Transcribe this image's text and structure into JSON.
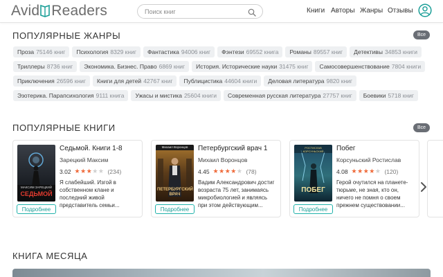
{
  "header": {
    "logo_left": "Avid",
    "logo_right": "Readers",
    "search_placeholder": "Поиск книг",
    "nav": [
      "Книги",
      "Авторы",
      "Жанры",
      "Отзывы"
    ]
  },
  "genres": {
    "title": "ПОПУЛЯРНЫЕ ЖАНРЫ",
    "all_label": "Все",
    "items": [
      {
        "name": "Проза",
        "count": "75146 книг"
      },
      {
        "name": "Психология",
        "count": "8329 книг"
      },
      {
        "name": "Фантастика",
        "count": "94006 книг"
      },
      {
        "name": "Фэнтези",
        "count": "69552 книга"
      },
      {
        "name": "Романы",
        "count": "89557 книг"
      },
      {
        "name": "Детективы",
        "count": "34853 книги"
      },
      {
        "name": "Триллеры",
        "count": "8736 книг"
      },
      {
        "name": "Экономика. Бизнес. Право",
        "count": "6869 книг"
      },
      {
        "name": "История. Исторические науки",
        "count": "31475 книг"
      },
      {
        "name": "Самосовершенствование",
        "count": "7804 книги"
      },
      {
        "name": "Приключения",
        "count": "26596 книг"
      },
      {
        "name": "Книги для детей",
        "count": "42767 книг"
      },
      {
        "name": "Публицистика",
        "count": "44604 книги"
      },
      {
        "name": "Деловая литература",
        "count": "9820 книг"
      },
      {
        "name": "Эзотерика. Парапсихология",
        "count": "9111 книга"
      },
      {
        "name": "Ужасы и мистика",
        "count": "25604 книги"
      },
      {
        "name": "Современная русская литература",
        "count": "27757 книг"
      },
      {
        "name": "Боевики",
        "count": "5718 книг"
      }
    ]
  },
  "books": {
    "title": "ПОПУЛЯРНЫЕ КНИГИ",
    "all_label": "Все",
    "more_label": "Подробнее",
    "items": [
      {
        "title": "Седьмой. Книги 1-8",
        "author": "Зарецкий Максим",
        "rating": "3.02",
        "stars": 3,
        "votes": "(234)",
        "desc": "Я слабейший. Изгой в собственном клане и последний живой представитель семьи...",
        "cover_author": "МАКСИМ ЗАРЕЦКИЙ",
        "cover_title": "СЕДЬМОЙ"
      },
      {
        "title": "Петербургский врач 1",
        "author": "Михаил Воронцов",
        "rating": "4.45",
        "stars": 4,
        "votes": "(78)",
        "desc": "Вадим Александрович достиг возраста 75 лет, занимаясь микробиологией и являясь при этом действующим...",
        "cover_author": "Михаил Воронцов",
        "cover_title": "ПЕТЕРБУРГСКИЙ ВРАЧ"
      },
      {
        "title": "Побег",
        "author": "Корсуньский Ростислав",
        "rating": "4.08",
        "stars": 4,
        "votes": "(120)",
        "desc": "Герой очутился на планете-тюрьме, не зная, кто он, ничего не помня о своем прежнем существовании...",
        "cover_author": "РОСТИСЛАВ КОРСУНЬСКИЙ",
        "cover_title": "ПОБЕГ"
      }
    ]
  },
  "month": {
    "title": "КНИГА МЕСЯЦА"
  },
  "colors": {
    "accent": "#20b2aa",
    "star": "#ef6a3a",
    "chip_bg": "#eef0f2",
    "all_btn": "#6a6e75"
  }
}
